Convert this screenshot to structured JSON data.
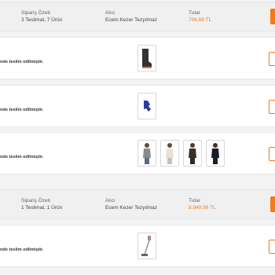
{
  "orders": [
    {
      "summary_label": "Sipariş Özeti",
      "summary_value": "3 Teslimat, 7 Ürün",
      "recipient_label": "Alıcı",
      "recipient_value": "Ecem Kezer Tezyılmaz",
      "amount_label": "Tutar",
      "amount_value": "706,69 TL",
      "deliveries": [
        {
          "status": "nde teslim edilmiştir.",
          "products": [
            "boot-icon"
          ]
        },
        {
          "status": "nde teslim edilmiştir.",
          "products": [
            "glove-icon"
          ]
        },
        {
          "status": "nde teslim edilmiştir.",
          "products": [
            "tank-top-icon",
            "tank-top-icon",
            "tank-top-icon",
            "tank-top-icon"
          ]
        }
      ]
    },
    {
      "summary_label": "Sipariş Özeti",
      "summary_value": "1 Teslimat, 1 Ürün",
      "recipient_label": "Alıcı",
      "recipient_value": "Ecem Kezer Tezyılmaz",
      "amount_label": "Tutar",
      "amount_value": "8.949,99 TL",
      "deliveries": [
        {
          "status": "nde teslim edilmiştir.",
          "products": [
            "stick-vacuum-icon"
          ]
        }
      ]
    }
  ],
  "colors": {
    "accent": "#f27a1a"
  }
}
